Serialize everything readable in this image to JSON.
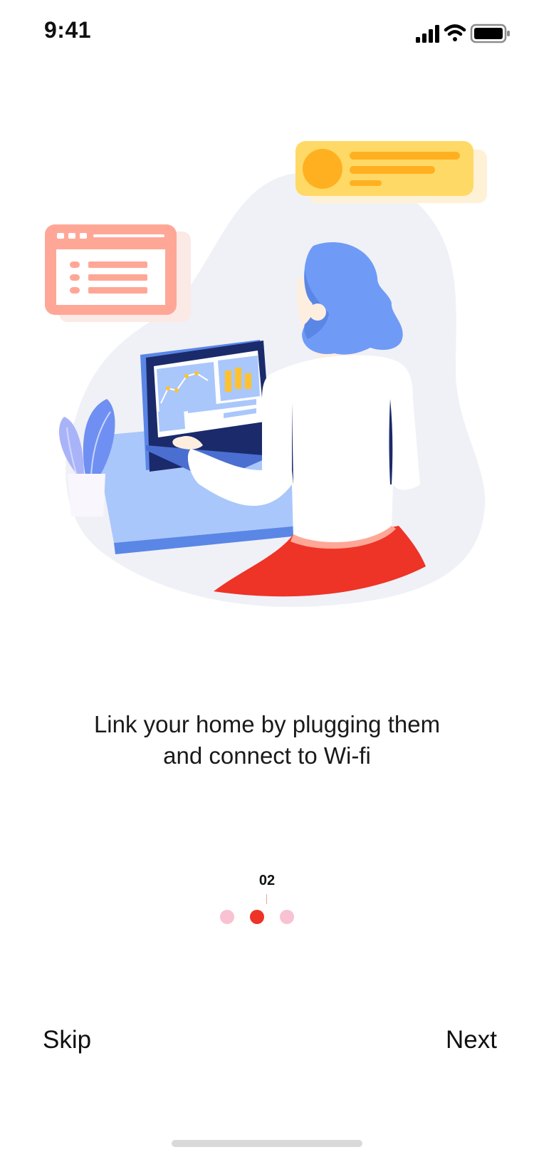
{
  "status_bar": {
    "time": "9:41",
    "icons": [
      "signal-icon",
      "wifi-icon",
      "battery-icon"
    ]
  },
  "onboarding": {
    "headline_line1": "Link your home by plugging them",
    "headline_line2": "and connect to Wi-fi",
    "page_number": "02",
    "total_pages": 3,
    "current_page": 2
  },
  "actions": {
    "skip_label": "Skip",
    "next_label": "Next"
  },
  "colors": {
    "accent": "#ee3327",
    "dot_inactive": "#f8c2d2",
    "hair": "#6f9bf6",
    "laptop_frame": "#1b2a6b",
    "card_yellow": "#ffd966",
    "card_salmon": "#ffa797"
  }
}
